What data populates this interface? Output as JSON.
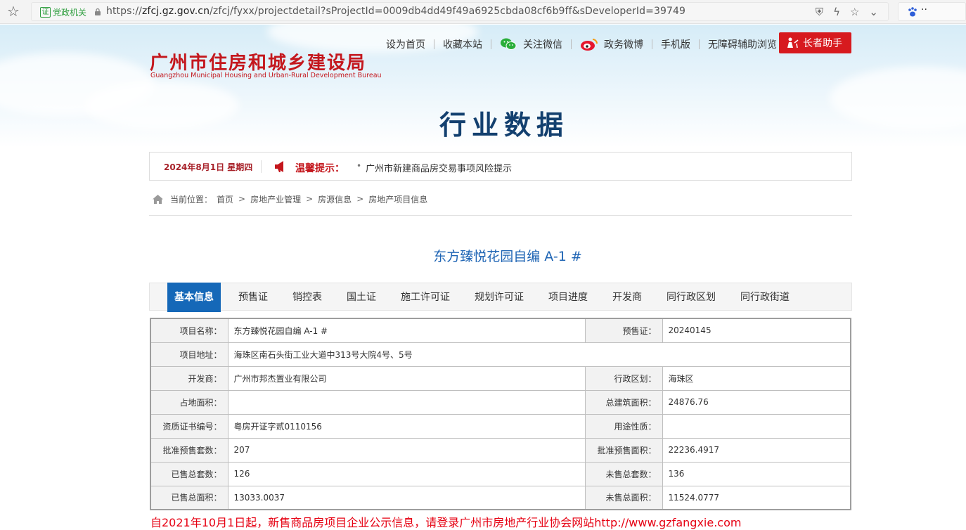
{
  "browser": {
    "cert_label": "党政机关",
    "cert_char": "证",
    "url_prefix": "https://",
    "url_host": "zfcj.gz.gov.cn",
    "url_path": "/zfcj/fyxx/projectdetail?sProjectId=0009db4dd49f49a6925cbda08cf6b9ff&sDeveloperId=39749",
    "side_tab_text": "··"
  },
  "header": {
    "logo_cn": "广州市住房和城乡建设局",
    "logo_en": "Guangzhou Municipal Housing and Urban-Rural Development Bureau",
    "nav": {
      "home": "设为首页",
      "favorite": "收藏本站",
      "wechat": "关注微信",
      "weibo": "政务微博",
      "mobile": "手机版",
      "accessible": "无障碍辅助浏览"
    },
    "elder_button": "长者助手",
    "section_title": "行业数据"
  },
  "notice": {
    "date": "2024年8月1日 星期四",
    "label": "温馨提示：",
    "text": "广州市新建商品房交易事项风险提示"
  },
  "breadcrumb": {
    "prefix": "当前位置：",
    "items": [
      "首页",
      "房地产业管理",
      "房源信息",
      "房地产项目信息"
    ]
  },
  "project": {
    "title": "东方臻悦花园自编 A-1 #",
    "tabs": [
      "基本信息",
      "预售证",
      "销控表",
      "国土证",
      "施工许可证",
      "规划许可证",
      "项目进度",
      "开发商",
      "同行政区划",
      "同行政街道"
    ],
    "rows": [
      {
        "l1": "项目名称：",
        "v1": "东方臻悦花园自编 A-1 #",
        "l2": "预售证：",
        "v2": "20240145"
      },
      {
        "l1": "项目地址：",
        "v1": "海珠区南石头街工业大道中313号大院4号、5号"
      },
      {
        "l1": "开发商：",
        "v1": "广州市邦杰置业有限公司",
        "l2": "行政区划：",
        "v2": "海珠区"
      },
      {
        "l1": "占地面积：",
        "v1": "",
        "l2": "总建筑面积：",
        "v2": "24876.76"
      },
      {
        "l1": "资质证书编号：",
        "v1": "粤房开证字贰0110156",
        "l2": "用途性质：",
        "v2": ""
      },
      {
        "l1": "批准预售套数：",
        "v1": "207",
        "l2": "批准预售面积：",
        "v2": "22236.4917"
      },
      {
        "l1": "已售总套数：",
        "v1": "126",
        "l2": "未售总套数：",
        "v2": "136"
      },
      {
        "l1": "已售总面积：",
        "v1": "13033.0037",
        "l2": "未售总面积：",
        "v2": "11524.0777"
      }
    ],
    "bottom_note": "自2021年10月1日起，新售商品房项目企业公示信息，请登录广州市房地产行业协会网站http://www.gzfangxie.com"
  },
  "colors": {
    "brand_red": "#c4171d",
    "title_navy": "#13406f",
    "link_blue": "#1e64b4",
    "tab_active": "#1568b8"
  }
}
